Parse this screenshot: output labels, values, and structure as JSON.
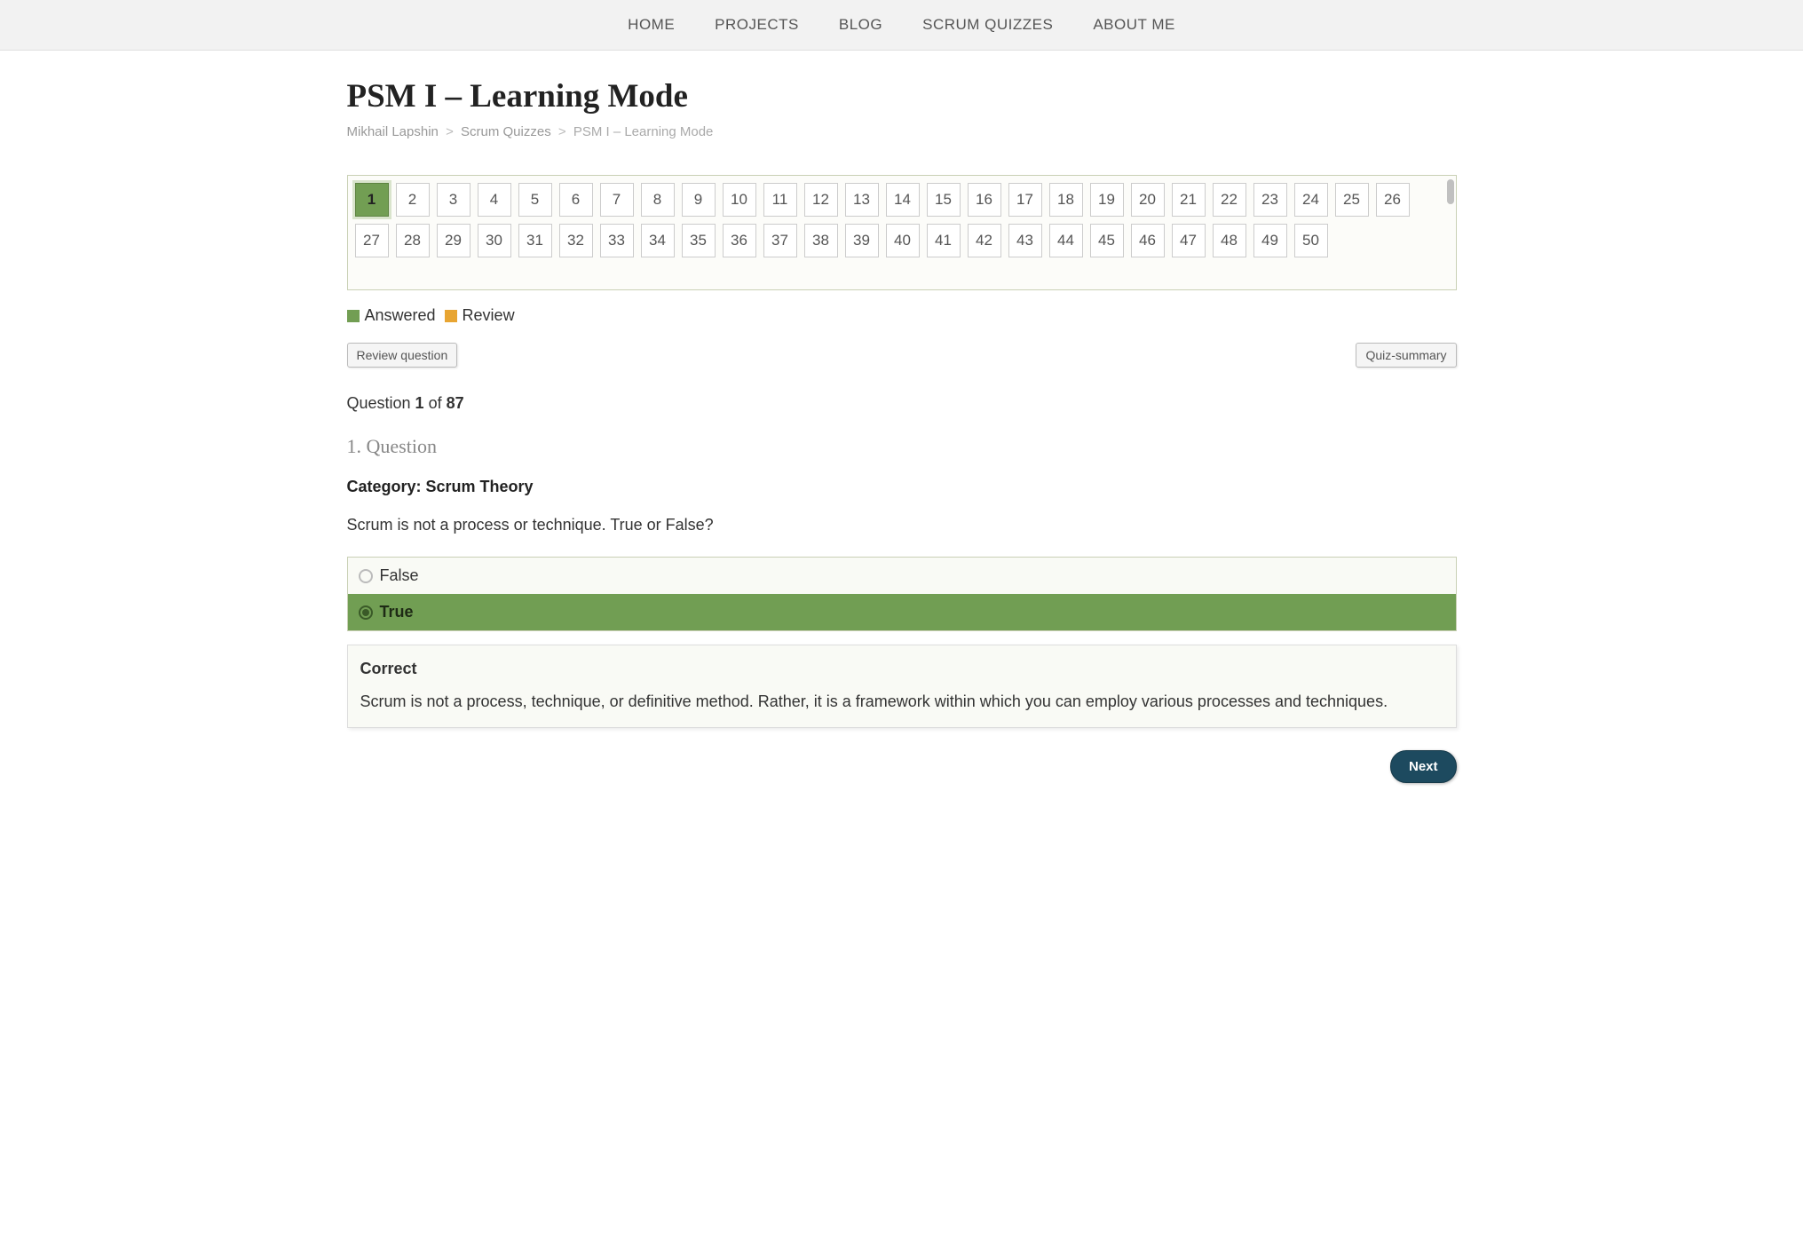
{
  "nav": {
    "items": [
      "HOME",
      "PROJECTS",
      "BLOG",
      "SCRUM QUIZZES",
      "ABOUT ME"
    ]
  },
  "page_title": "PSM I – Learning Mode",
  "breadcrumb": {
    "parts": [
      "Mikhail Lapshin",
      "Scrum Quizzes",
      "PSM I – Learning Mode"
    ]
  },
  "question_nav": {
    "total": 50,
    "active": 1
  },
  "legend": {
    "answered": "Answered",
    "review": "Review"
  },
  "buttons": {
    "review": "Review question",
    "summary": "Quiz-summary",
    "next": "Next"
  },
  "counter": {
    "prefix": "Question ",
    "current": "1",
    "of": " of ",
    "total": "87"
  },
  "question": {
    "heading": "1. Question",
    "category_label": "Category: Scrum Theory",
    "text": "Scrum is not a process or technique. True or False?",
    "options": [
      {
        "label": "False",
        "selected": false
      },
      {
        "label": "True",
        "selected": true
      }
    ]
  },
  "feedback": {
    "title": "Correct",
    "text": "Scrum is not a process, technique, or definitive method. Rather, it is a framework within which you can employ various processes and techniques."
  }
}
